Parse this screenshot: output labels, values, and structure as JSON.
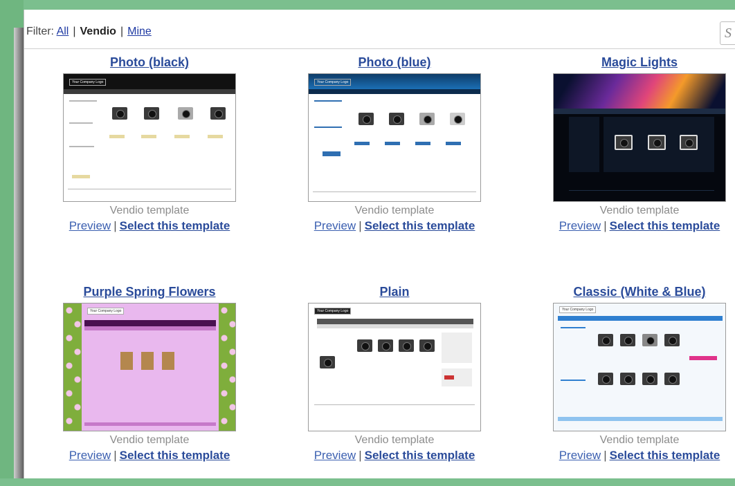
{
  "filter": {
    "label": "Filter:",
    "all": "All",
    "vendio": "Vendio",
    "mine": "Mine",
    "separator": "|",
    "search_glyph": "S"
  },
  "templates": [
    {
      "title": "Photo (black)",
      "caption": "Vendio template",
      "preview": "Preview",
      "select": "Select this template",
      "logo": "Your Company Logo"
    },
    {
      "title": "Photo (blue)",
      "caption": "Vendio template",
      "preview": "Preview",
      "select": "Select this template",
      "logo": "Your Company Logo"
    },
    {
      "title": "Magic Lights",
      "caption": "Vendio template",
      "preview": "Preview",
      "select": "Select this template",
      "logo": ""
    },
    {
      "title": "Purple Spring Flowers",
      "caption": "Vendio template",
      "preview": "Preview",
      "select": "Select this template",
      "logo": "Your Company Logo"
    },
    {
      "title": "Plain",
      "caption": "Vendio template",
      "preview": "Preview",
      "select": "Select this template",
      "logo": "Your Company Logo"
    },
    {
      "title": "Classic (White & Blue)",
      "caption": "Vendio template",
      "preview": "Preview",
      "select": "Select this template",
      "logo": "Your Company Logo"
    }
  ],
  "colors": {
    "frame": "#7bbf8e",
    "link": "#2a4b9a",
    "caption": "#8c8c8c"
  }
}
